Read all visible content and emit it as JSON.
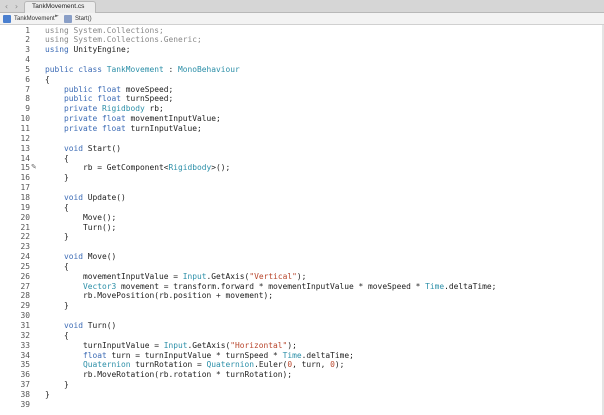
{
  "nav": {
    "back_icon": "chevron-left-icon",
    "forward_icon": "chevron-right-icon"
  },
  "tab": {
    "label": "TankMovement.cs"
  },
  "breadcrumb": {
    "file": "TankMovement",
    "separator": "►",
    "method": "Start()"
  },
  "editor": {
    "colors": {
      "keyword": "#3c6bb5",
      "type": "#2c8fa8",
      "string": "#b8452b",
      "using_dim": "#8a8a8a"
    },
    "lines": [
      {
        "n": "1",
        "t": [
          [
            "g",
            "using"
          ],
          [
            "g",
            " System.Collections;"
          ]
        ]
      },
      {
        "n": "2",
        "t": [
          [
            "g",
            "using"
          ],
          [
            "g",
            " System.Collections.Generic;"
          ]
        ]
      },
      {
        "n": "3",
        "t": [
          [
            "k",
            "using"
          ],
          [
            "p",
            " UnityEngine;"
          ]
        ]
      },
      {
        "n": "4",
        "t": []
      },
      {
        "n": "5",
        "t": [
          [
            "k",
            "public class "
          ],
          [
            "y",
            "TankMovement"
          ],
          [
            "p",
            " : "
          ],
          [
            "y",
            "MonoBehaviour"
          ]
        ]
      },
      {
        "n": "6",
        "t": [
          [
            "p",
            "{"
          ]
        ]
      },
      {
        "n": "7",
        "t": [
          [
            "p",
            "    "
          ],
          [
            "k",
            "public float"
          ],
          [
            "p",
            " moveSpeed;"
          ]
        ]
      },
      {
        "n": "8",
        "t": [
          [
            "p",
            "    "
          ],
          [
            "k",
            "public float"
          ],
          [
            "p",
            " turnSpeed;"
          ]
        ]
      },
      {
        "n": "9",
        "t": [
          [
            "p",
            "    "
          ],
          [
            "k",
            "private "
          ],
          [
            "y",
            "Rigidbody"
          ],
          [
            "p",
            " rb;"
          ]
        ]
      },
      {
        "n": "10",
        "t": [
          [
            "p",
            "    "
          ],
          [
            "k",
            "private float"
          ],
          [
            "p",
            " movementInputValue;"
          ]
        ]
      },
      {
        "n": "11",
        "t": [
          [
            "p",
            "    "
          ],
          [
            "k",
            "private float"
          ],
          [
            "p",
            " turnInputValue;"
          ]
        ]
      },
      {
        "n": "12",
        "t": []
      },
      {
        "n": "13",
        "t": [
          [
            "p",
            "    "
          ],
          [
            "k",
            "void"
          ],
          [
            "p",
            " Start()"
          ]
        ]
      },
      {
        "n": "14",
        "t": [
          [
            "p",
            "    {"
          ]
        ]
      },
      {
        "n": "15",
        "t": [
          [
            "p",
            "        rb = GetComponent<"
          ],
          [
            "y",
            "Rigidbody"
          ],
          [
            "p",
            ">();"
          ]
        ],
        "mark": true
      },
      {
        "n": "16",
        "t": [
          [
            "p",
            "    }"
          ]
        ]
      },
      {
        "n": "17",
        "t": []
      },
      {
        "n": "18",
        "t": [
          [
            "p",
            "    "
          ],
          [
            "k",
            "void"
          ],
          [
            "p",
            " Update()"
          ]
        ]
      },
      {
        "n": "19",
        "t": [
          [
            "p",
            "    {"
          ]
        ]
      },
      {
        "n": "20",
        "t": [
          [
            "p",
            "        Move();"
          ]
        ]
      },
      {
        "n": "21",
        "t": [
          [
            "p",
            "        Turn();"
          ]
        ]
      },
      {
        "n": "22",
        "t": [
          [
            "p",
            "    }"
          ]
        ]
      },
      {
        "n": "23",
        "t": []
      },
      {
        "n": "24",
        "t": [
          [
            "p",
            "    "
          ],
          [
            "k",
            "void"
          ],
          [
            "p",
            " Move()"
          ]
        ]
      },
      {
        "n": "25",
        "t": [
          [
            "p",
            "    {"
          ]
        ]
      },
      {
        "n": "26",
        "t": [
          [
            "p",
            "        movementInputValue = "
          ],
          [
            "y",
            "Input"
          ],
          [
            "p",
            ".GetAxis("
          ],
          [
            "s",
            "\"Vertical\""
          ],
          [
            "p",
            ");"
          ]
        ]
      },
      {
        "n": "27",
        "t": [
          [
            "p",
            "        "
          ],
          [
            "y",
            "Vector3"
          ],
          [
            "p",
            " movement = transform.forward * movementInputValue * moveSpeed * "
          ],
          [
            "y",
            "Time"
          ],
          [
            "p",
            ".deltaTime;"
          ]
        ]
      },
      {
        "n": "28",
        "t": [
          [
            "p",
            "        rb.MovePosition(rb.position + movement);"
          ]
        ]
      },
      {
        "n": "29",
        "t": [
          [
            "p",
            "    }"
          ]
        ]
      },
      {
        "n": "30",
        "t": []
      },
      {
        "n": "31",
        "t": [
          [
            "p",
            "    "
          ],
          [
            "k",
            "void"
          ],
          [
            "p",
            " Turn()"
          ]
        ]
      },
      {
        "n": "32",
        "t": [
          [
            "p",
            "    {"
          ]
        ]
      },
      {
        "n": "33",
        "t": [
          [
            "p",
            "        turnInputValue = "
          ],
          [
            "y",
            "Input"
          ],
          [
            "p",
            ".GetAxis("
          ],
          [
            "s",
            "\"Horizontal\""
          ],
          [
            "p",
            ");"
          ]
        ]
      },
      {
        "n": "34",
        "t": [
          [
            "p",
            "        "
          ],
          [
            "k",
            "float"
          ],
          [
            "p",
            " turn = turnInputValue * turnSpeed * "
          ],
          [
            "y",
            "Time"
          ],
          [
            "p",
            ".deltaTime;"
          ]
        ]
      },
      {
        "n": "35",
        "t": [
          [
            "p",
            "        "
          ],
          [
            "y",
            "Quaternion"
          ],
          [
            "p",
            " turnRotation = "
          ],
          [
            "y",
            "Quaternion"
          ],
          [
            "p",
            ".Euler("
          ],
          [
            "s",
            "0"
          ],
          [
            "p",
            ", turn, "
          ],
          [
            "s",
            "0"
          ],
          [
            "p",
            ");"
          ]
        ]
      },
      {
        "n": "36",
        "t": [
          [
            "p",
            "        rb.MoveRotation(rb.rotation * turnRotation);"
          ]
        ]
      },
      {
        "n": "37",
        "t": [
          [
            "p",
            "    }"
          ]
        ]
      },
      {
        "n": "38",
        "t": [
          [
            "p",
            "}"
          ]
        ]
      },
      {
        "n": "39",
        "t": []
      }
    ]
  }
}
